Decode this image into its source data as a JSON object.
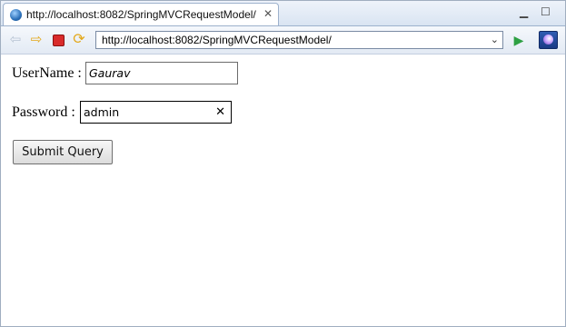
{
  "tab": {
    "title": "http://localhost:8082/SpringMVCRequestModel/",
    "close_icon": "close-icon",
    "favicon": "globe-icon"
  },
  "window_controls": {
    "minimize": "minimize-icon",
    "maximize": "maximize-icon"
  },
  "toolbar": {
    "back_icon": "back-arrow-icon",
    "forward_icon": "forward-arrow-icon",
    "stop_icon": "stop-icon",
    "refresh_icon": "refresh-icon",
    "url": "http://localhost:8082/SpringMVCRequestModel/",
    "go_icon": "go-icon",
    "eclipse_icon": "eclipse-icon"
  },
  "form": {
    "username_label": "UserName :",
    "username_value": "Gaurav",
    "password_label": "Password :",
    "password_value": "admin",
    "submit_label": "Submit Query"
  },
  "colors": {
    "accent": "#2a6fb8",
    "stop": "#d92b2b",
    "go": "#2ea043"
  }
}
